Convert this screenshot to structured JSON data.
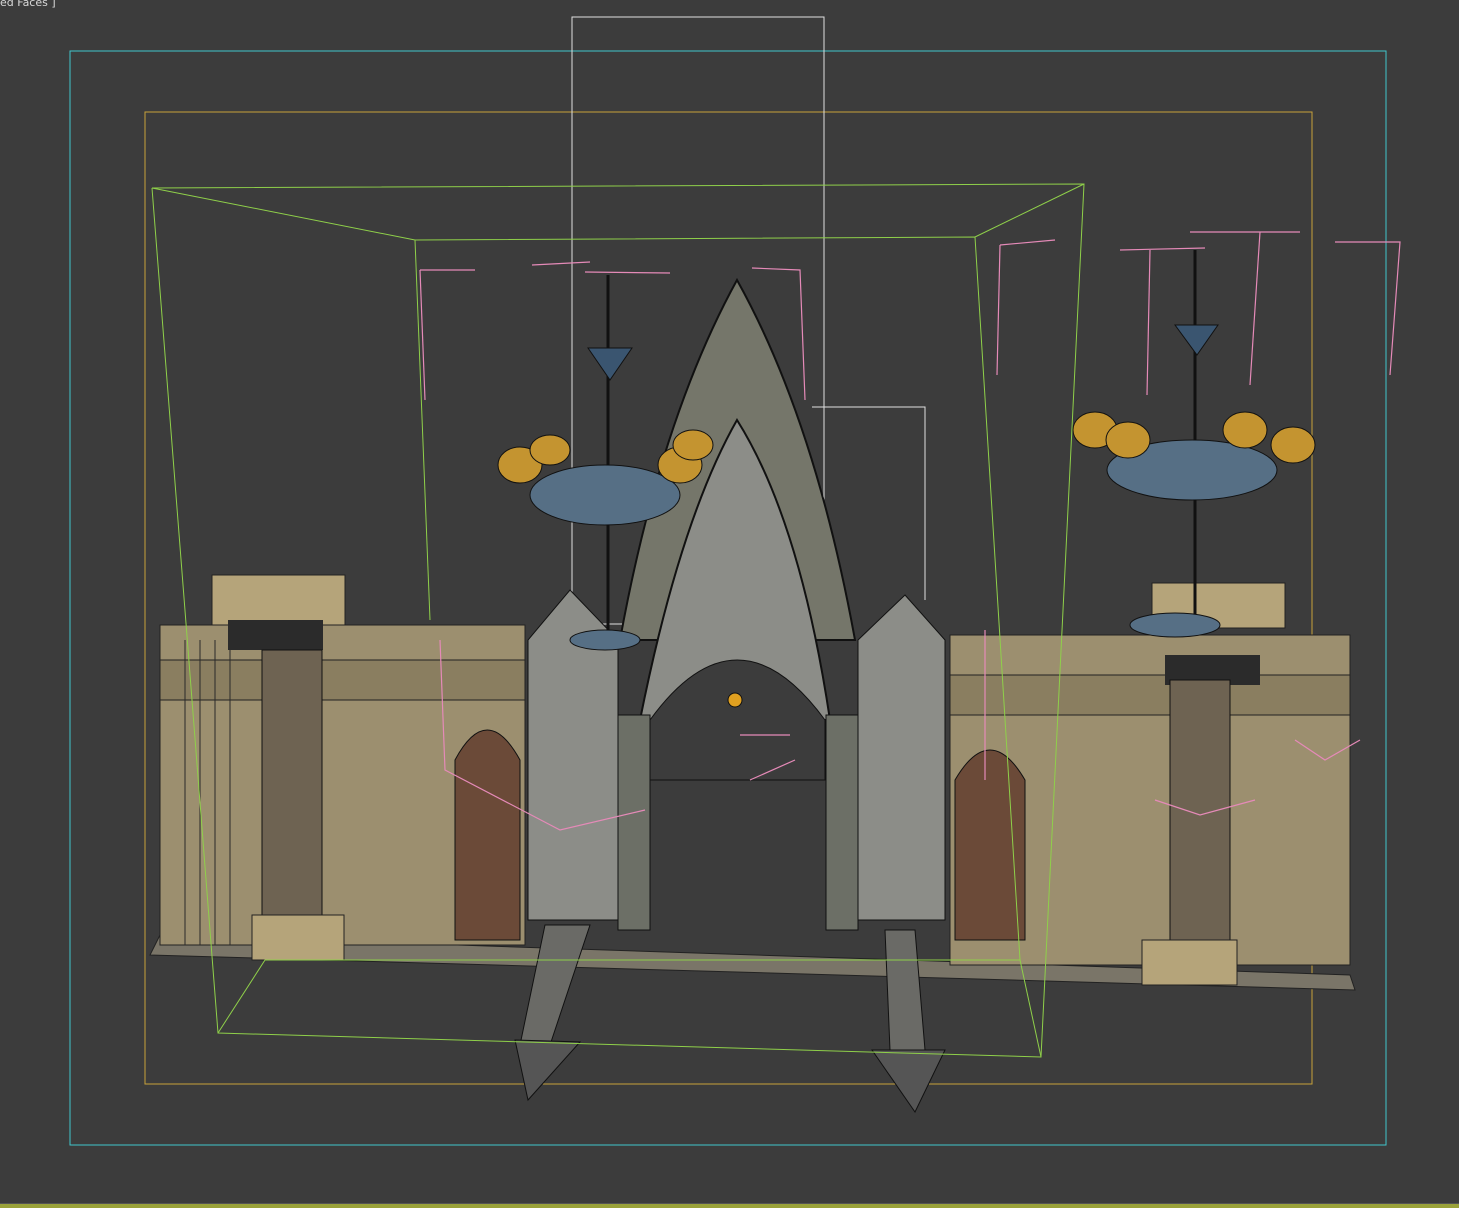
{
  "viewport": {
    "label": "ed Faces ]",
    "active_border_color": "#9aa23a",
    "background_color": "#3c3c3c"
  },
  "scene": {
    "safe_frame_outer_color": "#3fc6cc",
    "safe_frame_inner_color": "#c8a23a",
    "bounding_box_color": "#8fd04a",
    "light_gizmo_color": "#e58ab8"
  }
}
